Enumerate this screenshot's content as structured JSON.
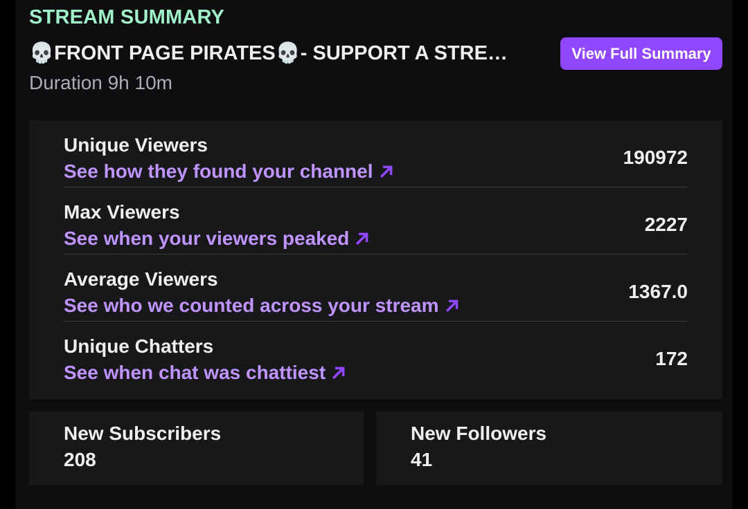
{
  "colors": {
    "section_title": "#a0f0c8",
    "link": "#bf94ff",
    "arrow": "#9147ff",
    "button_bg": "#9147ff"
  },
  "summary": {
    "section_title": "STREAM SUMMARY",
    "stream_title": "💀FRONT PAGE PIRATES💀- SUPPORT A STRE…",
    "duration": "Duration 9h 10m",
    "view_full_label": "View Full Summary"
  },
  "stats": [
    {
      "label": "Unique Viewers",
      "link": "See how they found your channel",
      "value": "190972",
      "icon": "arrow-up-right-icon"
    },
    {
      "label": "Max Viewers",
      "link": "See when your viewers peaked",
      "value": "2227",
      "icon": "arrow-up-right-icon"
    },
    {
      "label": "Average Viewers",
      "link": "See who we counted across your stream",
      "value": "1367.0",
      "icon": "arrow-up-right-icon"
    },
    {
      "label": "Unique Chatters",
      "link": "See when chat was chattiest",
      "value": "172",
      "icon": "arrow-up-right-icon"
    }
  ],
  "cards": {
    "subscribers": {
      "label": "New Subscribers",
      "value": "208"
    },
    "followers": {
      "label": "New Followers",
      "value": "41"
    }
  }
}
